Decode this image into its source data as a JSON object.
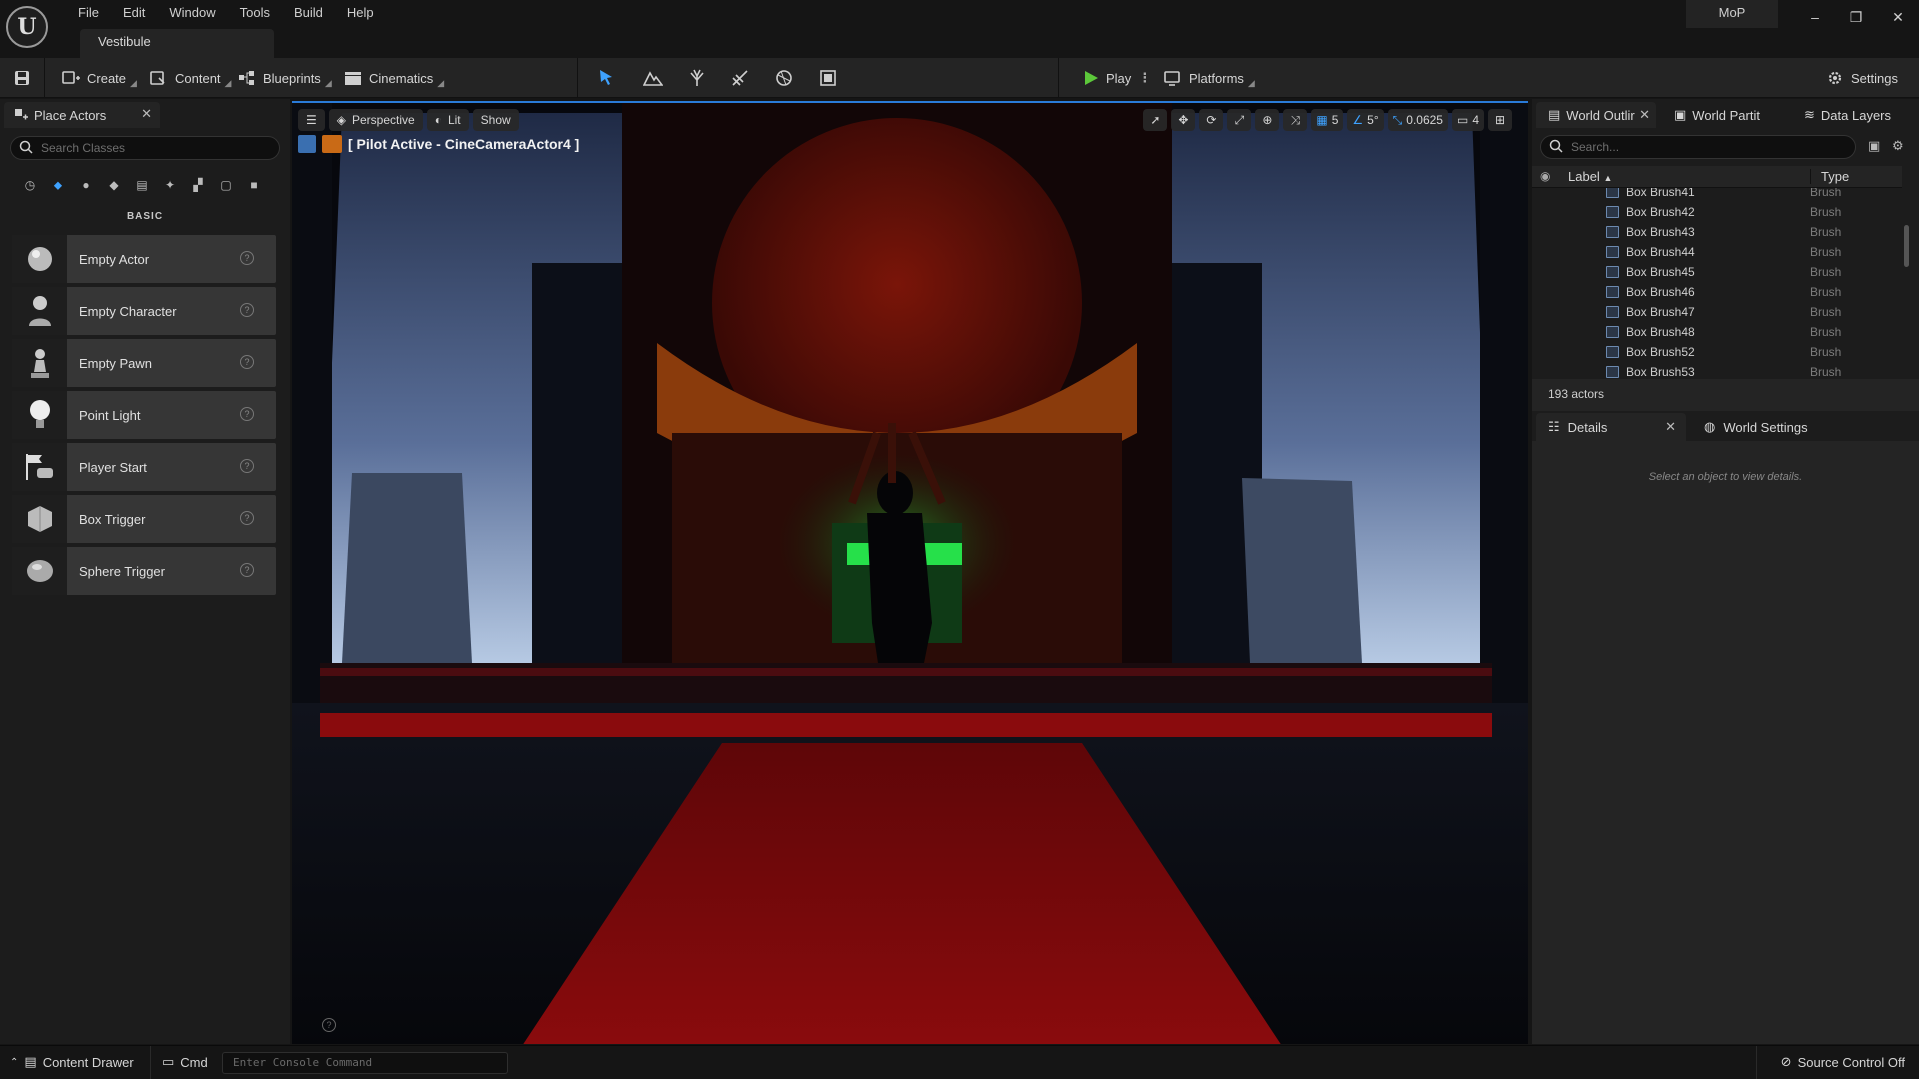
{
  "menu": [
    "File",
    "Edit",
    "Window",
    "Tools",
    "Build",
    "Help"
  ],
  "level_tab": "Vestibule",
  "user": "MoP",
  "toolbar": {
    "create": "Create",
    "content": "Content",
    "blueprints": "Blueprints",
    "cinematics": "Cinematics",
    "play": "Play",
    "platforms": "Platforms",
    "settings": "Settings"
  },
  "place_actors": {
    "tab": "Place Actors",
    "search_placeholder": "Search Classes",
    "category": "BASIC",
    "items": [
      {
        "label": "Empty Actor",
        "icon": "sphere-icon"
      },
      {
        "label": "Empty Character",
        "icon": "character-icon"
      },
      {
        "label": "Empty Pawn",
        "icon": "pawn-icon"
      },
      {
        "label": "Point Light",
        "icon": "light-bulb-icon"
      },
      {
        "label": "Player Start",
        "icon": "player-start-icon"
      },
      {
        "label": "Box Trigger",
        "icon": "box-trigger-icon"
      },
      {
        "label": "Sphere Trigger",
        "icon": "sphere-trigger-icon"
      }
    ]
  },
  "viewport": {
    "perspective": "Perspective",
    "lit": "Lit",
    "show": "Show",
    "pilot": "[ Pilot Active - CineCameraActor4 ]",
    "grid": "5",
    "angle": "5°",
    "scale": "0.0625",
    "camera_speed": "4"
  },
  "outliner": {
    "tabs": [
      "World Outlir",
      "World Partit",
      "Data Layers"
    ],
    "search_placeholder": "Search...",
    "col_label": "Label",
    "col_type": "Type",
    "rows": [
      {
        "name": "Box Brush41",
        "type": "Brush"
      },
      {
        "name": "Box Brush42",
        "type": "Brush"
      },
      {
        "name": "Box Brush43",
        "type": "Brush"
      },
      {
        "name": "Box Brush44",
        "type": "Brush"
      },
      {
        "name": "Box Brush45",
        "type": "Brush"
      },
      {
        "name": "Box Brush46",
        "type": "Brush"
      },
      {
        "name": "Box Brush47",
        "type": "Brush"
      },
      {
        "name": "Box Brush48",
        "type": "Brush"
      },
      {
        "name": "Box Brush52",
        "type": "Brush"
      },
      {
        "name": "Box Brush53",
        "type": "Brush"
      }
    ],
    "count": "193 actors"
  },
  "details": {
    "tab": "Details",
    "world_settings_tab": "World Settings",
    "hint": "Select an object to view details."
  },
  "statusbar": {
    "content_drawer": "Content Drawer",
    "cmd": "Cmd",
    "console_placeholder": "Enter Console Command",
    "source_control": "Source Control Off"
  },
  "colors": {
    "accent": "#2a7bd8",
    "play_green": "#5cc83a",
    "carpet_red": "#7a0a0a"
  }
}
